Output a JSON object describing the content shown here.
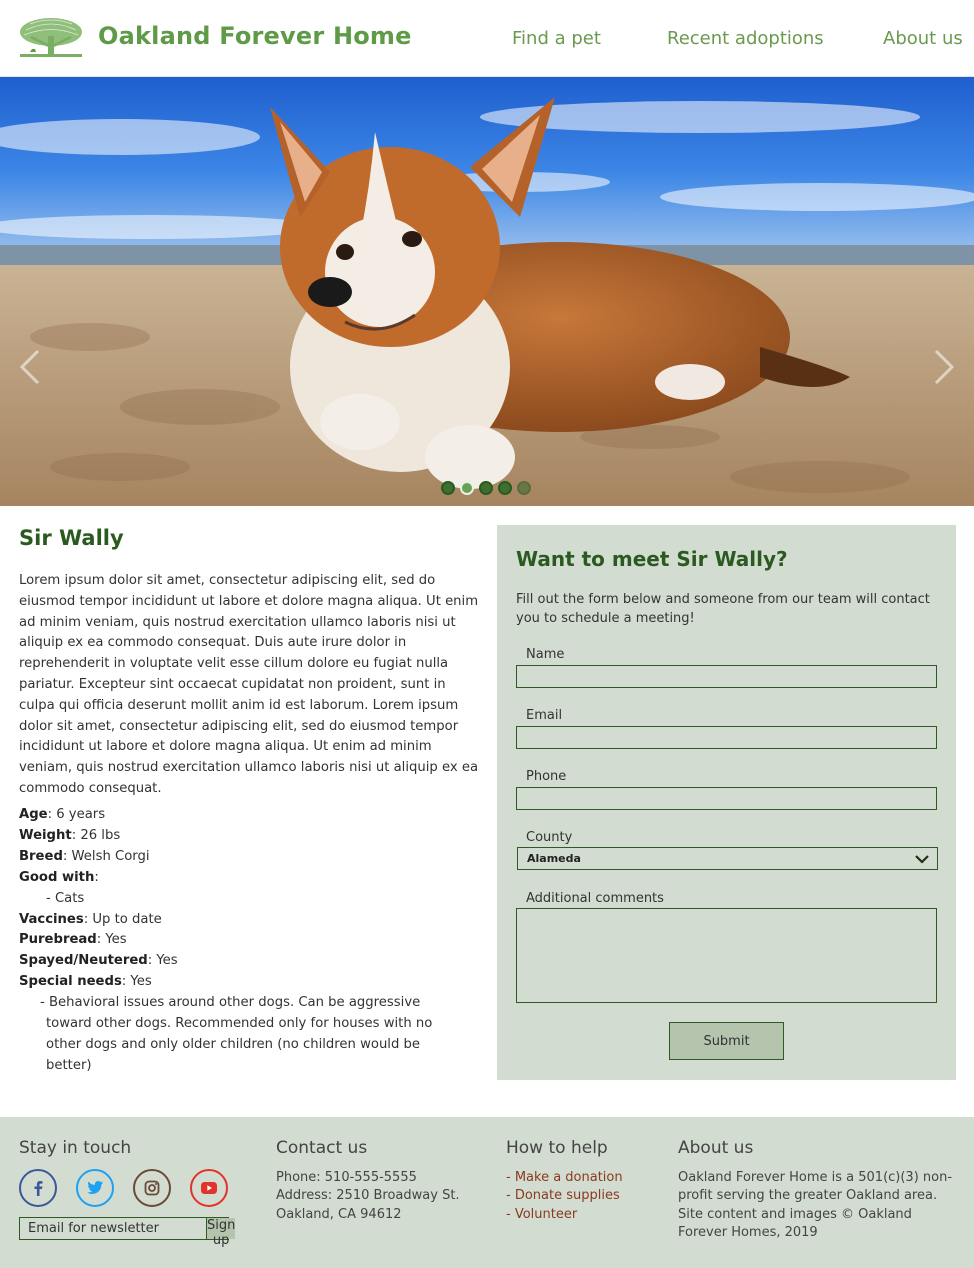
{
  "header": {
    "brand": "Oakland Forever Home",
    "nav": [
      {
        "label": "Find a pet"
      },
      {
        "label": "Recent adoptions"
      },
      {
        "label": "About us"
      }
    ]
  },
  "hero": {
    "slide_count": 5,
    "active_slide": 2
  },
  "pet": {
    "name": "Sir Wally",
    "description": "Lorem ipsum dolor sit amet, consectetur adipiscing elit, sed do eiusmod tempor incididunt ut labore et dolore magna aliqua. Ut enim ad minim veniam, quis nostrud exercitation ullamco laboris nisi ut aliquip ex ea commodo consequat. Duis aute irure dolor in reprehenderit in voluptate velit esse cillum dolore eu fugiat nulla pariatur. Excepteur sint occaecat cupidatat non proident, sunt in culpa qui officia deserunt mollit anim id est laborum. Lorem ipsum dolor sit amet, consectetur adipiscing elit, sed do eiusmod tempor incididunt ut labore et dolore magna aliqua. Ut enim ad minim veniam, quis nostrud exercitation ullamco laboris nisi ut aliquip ex ea commodo consequat.",
    "facts": {
      "age_label": "Age",
      "age": ": 6 years",
      "weight_label": "Weight",
      "weight": ": 26 lbs",
      "breed_label": "Breed",
      "breed": ": Welsh Corgi",
      "good_with_label": "Good with",
      "good_with": ":",
      "good_with_item": "- Cats",
      "vaccines_label": "Vaccines",
      "vaccines": ": Up to date",
      "purebread_label": "Purebread",
      "purebread": ": Yes",
      "spayed_label": "Spayed/Neutered",
      "spayed": ": Yes",
      "special_label": "Special needs",
      "special": ": Yes",
      "special_item": "- Behavioral issues around other dogs.  Can be aggressive toward other dogs.  Recommended only for houses with no other dogs and only older children (no children would be better)"
    }
  },
  "form": {
    "title": "Want to meet Sir Wally?",
    "intro": "Fill out the form below and someone from our team will contact you to schedule a meeting!",
    "name_label": "Name",
    "email_label": "Email",
    "phone_label": "Phone",
    "county_label": "County",
    "county_value": "Alameda",
    "comments_label": "Additional comments",
    "submit_label": "Submit"
  },
  "footer": {
    "stay_title": "Stay in touch",
    "social": [
      "facebook-icon",
      "twitter-icon",
      "instagram-icon",
      "youtube-icon"
    ],
    "newsletter_placeholder": "Email for newsletter",
    "signup_label": "Sign up",
    "contact_title": "Contact us",
    "phone": "Phone: 510-555-5555",
    "address1": "Address: 2510 Broadway St.",
    "address2": "Oakland, CA 94612",
    "help_title": "How to help",
    "help_links": [
      "- Make a donation",
      "- Donate supplies",
      "- Volunteer"
    ],
    "about_title": "About us",
    "about_text": "Oakland Forever Home is a 501(c)(3) non-profit serving the greater Oakland area. Site content and images © Oakland Forever Homes, 2019"
  },
  "colors": {
    "brand_green": "#5f9a47",
    "dark_green": "#2b5a20",
    "panel_bg": "#d3dcd1",
    "button_bg": "#b4c4ad",
    "link_brown": "#8a3a1f"
  }
}
